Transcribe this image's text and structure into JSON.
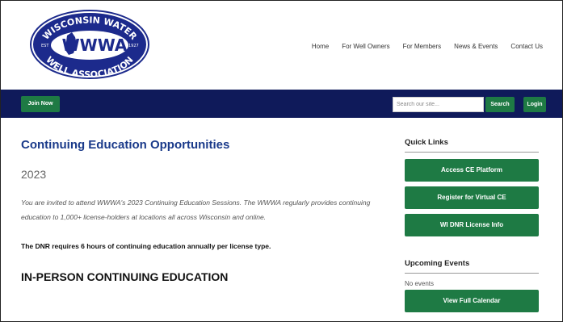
{
  "logo": {
    "top_text": "WISCONSIN WATER",
    "abbrev": "WWWA",
    "bottom_text": "WELL ASSOCIATION",
    "year_left": "EST",
    "year_right": "1927",
    "colors": {
      "oval": "#1c2a8c",
      "ring": "#ffffff",
      "accent": "#4aa0e0"
    }
  },
  "topnav": {
    "items": [
      "Home",
      "For Well Owners",
      "For Members",
      "News & Events",
      "Contact Us"
    ]
  },
  "navbar": {
    "join_label": "Join Now",
    "search_placeholder": "Search our site...",
    "search_label": "Search",
    "login_label": "Login"
  },
  "main": {
    "title": "Continuing Education Opportunities",
    "year": "2023",
    "intro": "You are invited to attend WWWA's 2023 Continuing Education Sessions. The WWWA regularly provides continuing education to 1,000+ license-holders at locations all across Wisconsin and online.",
    "dnr_note": "The DNR requires 6 hours of continuing education annually per license type.",
    "section_title": "IN-PERSON CONTINUING EDUCATION"
  },
  "sidebar": {
    "quick_links_title": "Quick Links",
    "links": [
      "Access CE Platform",
      "Register for Virtual CE",
      "WI DNR License Info"
    ],
    "events_title": "Upcoming Events",
    "no_events": "No events",
    "calendar_label": "View Full Calendar"
  },
  "colors": {
    "navy": "#0f1a5a",
    "green": "#1e7a44",
    "title_blue": "#1a3a8a"
  }
}
